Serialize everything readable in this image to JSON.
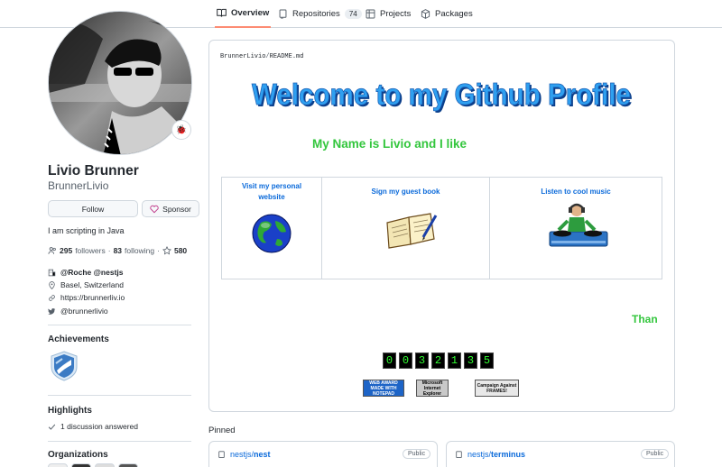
{
  "nav": {
    "tabs": [
      {
        "label": "Overview"
      },
      {
        "label": "Repositories",
        "count": "74"
      },
      {
        "label": "Projects"
      },
      {
        "label": "Packages"
      }
    ],
    "active_color": "#fd8c73"
  },
  "profile": {
    "name": "Livio Brunner",
    "username": "BrunnerLivio",
    "status_emoji": "🐞",
    "follow_label": "Follow",
    "sponsor_label": "Sponsor",
    "bio": "I am scripting in Java",
    "followers_count": "295",
    "followers_label": "followers",
    "following_count": "83",
    "following_label": "following",
    "stars_count": "580",
    "company_prefix": "@Roche",
    "company_extra": "@nestjs",
    "location": "Basel, Switzerland",
    "website": "https://brunnerliv.io",
    "twitter": "@brunnerlivio"
  },
  "sidebar": {
    "achievements_title": "Achievements",
    "highlights_title": "Highlights",
    "highlight_item": "1 discussion answered",
    "organizations_title": "Organizations"
  },
  "readme": {
    "path_owner": "BrunnerLivio",
    "path_sep": "/",
    "path_file": "README.md",
    "welcome_text": "Welcome to my Github Profile",
    "name_line": "My Name is Livio and I like",
    "links": [
      {
        "label": "Visit my personal website"
      },
      {
        "label": "Sign my guest book"
      },
      {
        "label": "Listen to cool music"
      }
    ],
    "than_text": "Than",
    "visitor_digits": [
      "0",
      "0",
      "3",
      "2",
      "1",
      "3",
      "5"
    ],
    "badges": [
      {
        "label": "WEB AWARD MADE WITH NOTEPAD"
      },
      {
        "label": "Microsoft Internet Explorer"
      },
      {
        "label": "Campaign Against FRAMES!"
      }
    ],
    "accent_green": "#33c63d"
  },
  "pinned": {
    "title": "Pinned",
    "repos": [
      {
        "owner": "nestjs/",
        "name": "nest",
        "visibility": "Public"
      },
      {
        "owner": "nestjs/",
        "name": "terminus",
        "visibility": "Public"
      }
    ]
  }
}
